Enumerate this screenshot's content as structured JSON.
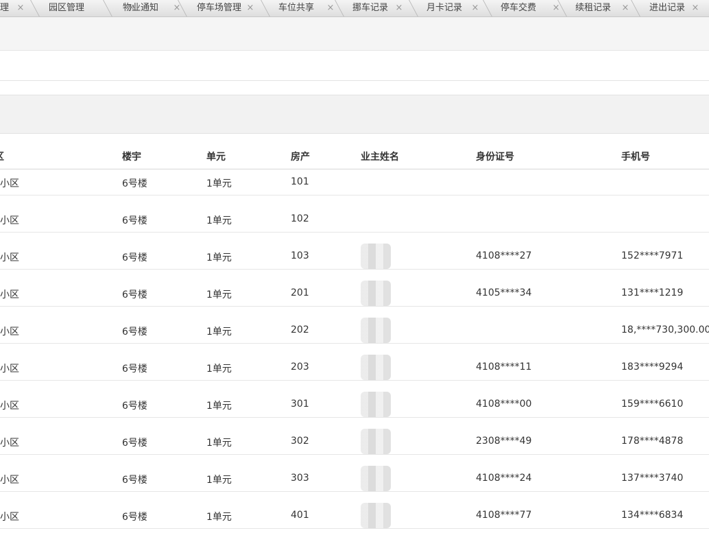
{
  "tabs": [
    {
      "label": "理"
    },
    {
      "label": "园区管理"
    },
    {
      "label": "物业通知"
    },
    {
      "label": "停车场管理"
    },
    {
      "label": "车位共享"
    },
    {
      "label": "挪车记录"
    },
    {
      "label": "月卡记录"
    },
    {
      "label": "停车交费"
    },
    {
      "label": "续租记录"
    },
    {
      "label": "进出记录"
    }
  ],
  "tab_close_glyph": "×",
  "table": {
    "columns": [
      "区",
      "楼宇",
      "单元",
      "房产",
      "业主姓名",
      "身份证号",
      "手机号"
    ],
    "rows": [
      {
        "community": "小区",
        "building": "6号楼",
        "unit": "1单元",
        "room": "101",
        "owner": "",
        "id_no": "",
        "phone": ""
      },
      {
        "community": "小区",
        "building": "6号楼",
        "unit": "1单元",
        "room": "102",
        "owner": "",
        "id_no": "",
        "phone": ""
      },
      {
        "community": "小区",
        "building": "6号楼",
        "unit": "1单元",
        "room": "103",
        "owner": "",
        "id_no": "4108****27",
        "phone": "152****7971"
      },
      {
        "community": "小区",
        "building": "6号楼",
        "unit": "1单元",
        "room": "201",
        "owner": "",
        "id_no": "4105****34",
        "phone": "131****1219"
      },
      {
        "community": "小区",
        "building": "6号楼",
        "unit": "1单元",
        "room": "202",
        "owner": "",
        "id_no": "",
        "phone": "18,****730,300.00"
      },
      {
        "community": "小区",
        "building": "6号楼",
        "unit": "1单元",
        "room": "203",
        "owner": "",
        "id_no": "4108****11",
        "phone": "183****9294"
      },
      {
        "community": "小区",
        "building": "6号楼",
        "unit": "1单元",
        "room": "301",
        "owner": "",
        "id_no": "4108****00",
        "phone": "159****6610"
      },
      {
        "community": "小区",
        "building": "6号楼",
        "unit": "1单元",
        "room": "302",
        "owner": "",
        "id_no": "2308****49",
        "phone": "178****4878"
      },
      {
        "community": "小区",
        "building": "6号楼",
        "unit": "1单元",
        "room": "303",
        "owner": "",
        "id_no": "4108****24",
        "phone": "137****3740"
      },
      {
        "community": "小区",
        "building": "6号楼",
        "unit": "1单元",
        "room": "401",
        "owner": "",
        "id_no": "4108****77",
        "phone": "134****6834"
      }
    ]
  }
}
